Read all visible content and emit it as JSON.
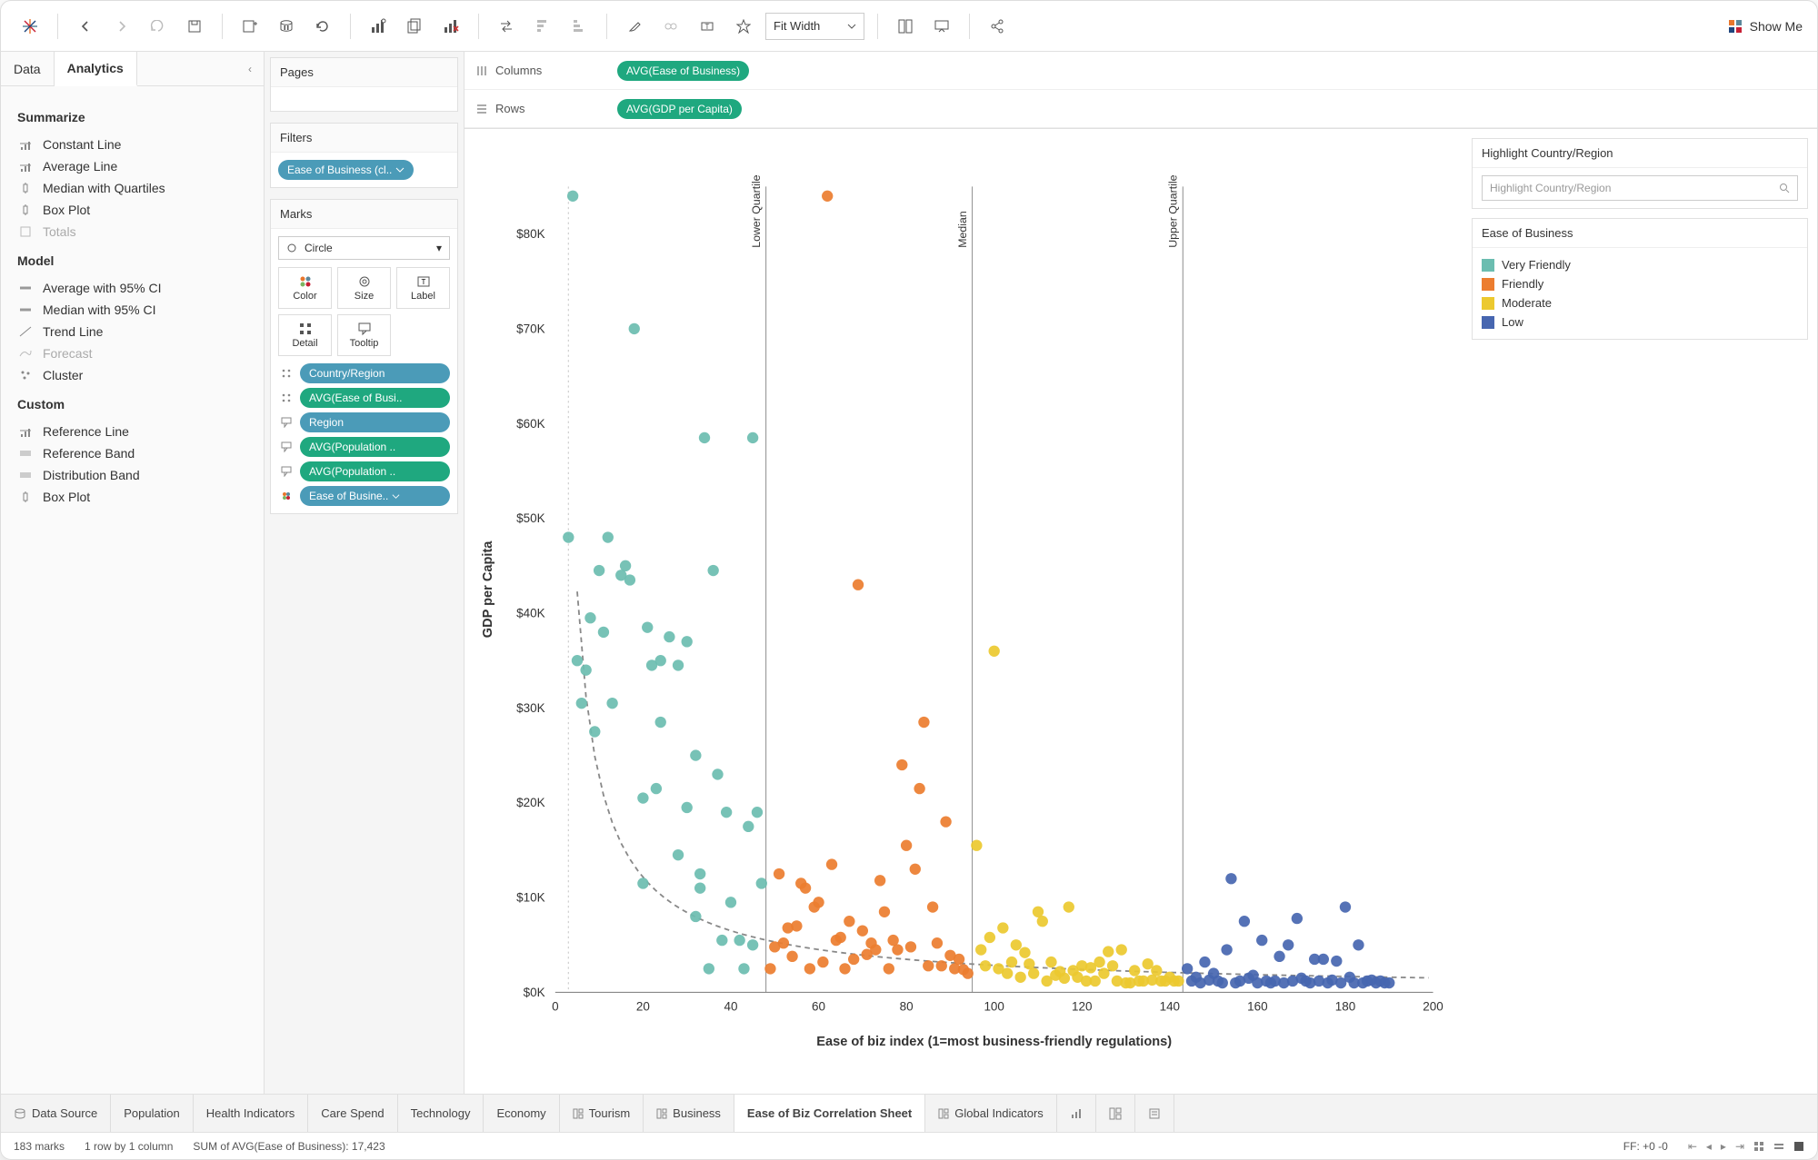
{
  "toolbar": {
    "fit_mode": "Fit Width",
    "show_me": "Show Me"
  },
  "left_tabs": {
    "data": "Data",
    "analytics": "Analytics",
    "active": "analytics"
  },
  "analytics": {
    "summarize_title": "Summarize",
    "summarize": [
      "Constant Line",
      "Average Line",
      "Median with Quartiles",
      "Box Plot",
      "Totals"
    ],
    "model_title": "Model",
    "model": [
      "Average with 95% CI",
      "Median with 95% CI",
      "Trend Line",
      "Forecast",
      "Cluster"
    ],
    "custom_title": "Custom",
    "custom": [
      "Reference Line",
      "Reference Band",
      "Distribution Band",
      "Box Plot"
    ]
  },
  "mid": {
    "pages": "Pages",
    "filters": "Filters",
    "filter_pill": "Ease of Business (cl..",
    "marks": "Marks",
    "mark_type": "Circle",
    "cells": {
      "color": "Color",
      "size": "Size",
      "label": "Label",
      "detail": "Detail",
      "tooltip": "Tooltip"
    },
    "mark_pills": [
      {
        "label": "Country/Region",
        "color": "blue",
        "icon": "detail"
      },
      {
        "label": "AVG(Ease of Busi..",
        "color": "green",
        "icon": "detail"
      },
      {
        "label": "Region",
        "color": "blue",
        "icon": "tooltip"
      },
      {
        "label": "AVG(Population ..",
        "color": "green",
        "icon": "tooltip"
      },
      {
        "label": "AVG(Population ..",
        "color": "green",
        "icon": "tooltip"
      },
      {
        "label": "Ease of Busine..",
        "color": "blue",
        "icon": "color"
      }
    ]
  },
  "shelves": {
    "columns_label": "Columns",
    "columns_pill": "AVG(Ease of Business)",
    "rows_label": "Rows",
    "rows_pill": "AVG(GDP per Capita)"
  },
  "right": {
    "highlight_title": "Highlight Country/Region",
    "highlight_placeholder": "Highlight Country/Region",
    "legend_title": "Ease of Business",
    "legend": [
      {
        "label": "Very Friendly",
        "color": "#6bbdb0"
      },
      {
        "label": "Friendly",
        "color": "#ec7d2f"
      },
      {
        "label": "Moderate",
        "color": "#ecc92f"
      },
      {
        "label": "Low",
        "color": "#4766b0"
      }
    ]
  },
  "sheet_tabs": {
    "data_source": "Data Source",
    "tabs": [
      "Population",
      "Health Indicators",
      "Care Spend",
      "Technology",
      "Economy",
      "Tourism",
      "Business",
      "Ease of Biz Correlation Sheet",
      "Global Indicators"
    ],
    "active": "Ease of Biz Correlation Sheet"
  },
  "statusbar": {
    "marks": "183 marks",
    "rowcol": "1 row by 1 column",
    "sum": "SUM of AVG(Ease of Business): 17,423",
    "ff": "FF: +0 -0"
  },
  "chart_data": {
    "type": "scatter",
    "title": "",
    "xlabel": "Ease of biz index (1=most business-friendly regulations)",
    "ylabel": "GDP per Capita",
    "xlim": [
      0,
      200
    ],
    "ylim": [
      0,
      85000
    ],
    "xticks": [
      0,
      20,
      40,
      60,
      80,
      100,
      120,
      140,
      160,
      180,
      200
    ],
    "yticks": [
      0,
      10000,
      20000,
      30000,
      40000,
      50000,
      60000,
      70000,
      80000
    ],
    "ytick_labels": [
      "$0K",
      "$10K",
      "$20K",
      "$30K",
      "$40K",
      "$50K",
      "$60K",
      "$70K",
      "$80K"
    ],
    "ref_lines": [
      {
        "label": "Lower Quartile",
        "x": 48
      },
      {
        "label": "Median",
        "x": 95
      },
      {
        "label": "Upper Quartile",
        "x": 143
      }
    ],
    "trend": {
      "kind": "power",
      "a": 180000,
      "b": -0.9
    },
    "series": [
      {
        "name": "Very Friendly",
        "color": "#6bbdb0",
        "points": [
          [
            3,
            48000
          ],
          [
            4,
            84000
          ],
          [
            5,
            35000
          ],
          [
            6,
            30500
          ],
          [
            7,
            34000
          ],
          [
            8,
            39500
          ],
          [
            9,
            27500
          ],
          [
            10,
            44500
          ],
          [
            11,
            38000
          ],
          [
            12,
            48000
          ],
          [
            13,
            30500
          ],
          [
            15,
            44000
          ],
          [
            16,
            45000
          ],
          [
            17,
            43500
          ],
          [
            18,
            70000
          ],
          [
            20,
            11500
          ],
          [
            20,
            20500
          ],
          [
            21,
            38500
          ],
          [
            22,
            34500
          ],
          [
            23,
            21500
          ],
          [
            24,
            28500
          ],
          [
            24,
            35000
          ],
          [
            26,
            37500
          ],
          [
            28,
            14500
          ],
          [
            28,
            34500
          ],
          [
            30,
            37000
          ],
          [
            30,
            19500
          ],
          [
            32,
            25000
          ],
          [
            32,
            8000
          ],
          [
            33,
            12500
          ],
          [
            33,
            11000
          ],
          [
            34,
            58500
          ],
          [
            35,
            2500
          ],
          [
            36,
            44500
          ],
          [
            37,
            23000
          ],
          [
            38,
            5500
          ],
          [
            39,
            19000
          ],
          [
            40,
            9500
          ],
          [
            42,
            5500
          ],
          [
            43,
            2500
          ],
          [
            44,
            17500
          ],
          [
            45,
            5000
          ],
          [
            45,
            58500
          ],
          [
            46,
            19000
          ],
          [
            47,
            11500
          ]
        ]
      },
      {
        "name": "Friendly",
        "color": "#ec7d2f",
        "points": [
          [
            49,
            2500
          ],
          [
            50,
            4800
          ],
          [
            51,
            12500
          ],
          [
            52,
            5200
          ],
          [
            53,
            6800
          ],
          [
            54,
            3800
          ],
          [
            55,
            7000
          ],
          [
            56,
            11500
          ],
          [
            57,
            11000
          ],
          [
            58,
            2500
          ],
          [
            59,
            9000
          ],
          [
            60,
            9500
          ],
          [
            61,
            3200
          ],
          [
            62,
            84000
          ],
          [
            63,
            13500
          ],
          [
            64,
            5500
          ],
          [
            65,
            5800
          ],
          [
            66,
            2500
          ],
          [
            67,
            7500
          ],
          [
            68,
            3500
          ],
          [
            69,
            43000
          ],
          [
            70,
            6500
          ],
          [
            71,
            4000
          ],
          [
            72,
            5200
          ],
          [
            73,
            4500
          ],
          [
            74,
            11800
          ],
          [
            75,
            8500
          ],
          [
            76,
            2500
          ],
          [
            77,
            5500
          ],
          [
            78,
            4500
          ],
          [
            79,
            24000
          ],
          [
            80,
            15500
          ],
          [
            81,
            4800
          ],
          [
            82,
            13000
          ],
          [
            83,
            21500
          ],
          [
            84,
            28500
          ],
          [
            85,
            2800
          ],
          [
            86,
            9000
          ],
          [
            87,
            5200
          ],
          [
            88,
            2800
          ],
          [
            89,
            18000
          ],
          [
            90,
            3900
          ],
          [
            91,
            2500
          ],
          [
            92,
            3500
          ],
          [
            93,
            2400
          ],
          [
            94,
            2000
          ]
        ]
      },
      {
        "name": "Moderate",
        "color": "#ecc92f",
        "points": [
          [
            96,
            15500
          ],
          [
            97,
            4500
          ],
          [
            98,
            2800
          ],
          [
            99,
            5800
          ],
          [
            100,
            36000
          ],
          [
            101,
            2500
          ],
          [
            102,
            6800
          ],
          [
            103,
            2000
          ],
          [
            104,
            3200
          ],
          [
            105,
            5000
          ],
          [
            106,
            1600
          ],
          [
            107,
            4200
          ],
          [
            108,
            3000
          ],
          [
            109,
            2000
          ],
          [
            110,
            8500
          ],
          [
            111,
            7500
          ],
          [
            112,
            1200
          ],
          [
            113,
            3200
          ],
          [
            114,
            1800
          ],
          [
            115,
            2200
          ],
          [
            116,
            1500
          ],
          [
            117,
            9000
          ],
          [
            118,
            2300
          ],
          [
            119,
            1600
          ],
          [
            120,
            2800
          ],
          [
            121,
            1200
          ],
          [
            122,
            2600
          ],
          [
            123,
            1200
          ],
          [
            124,
            3200
          ],
          [
            125,
            2000
          ],
          [
            126,
            4300
          ],
          [
            127,
            2800
          ],
          [
            128,
            1200
          ],
          [
            129,
            4500
          ],
          [
            130,
            1000
          ],
          [
            131,
            1000
          ],
          [
            132,
            2300
          ],
          [
            133,
            1200
          ],
          [
            134,
            1200
          ],
          [
            135,
            3000
          ],
          [
            136,
            1300
          ],
          [
            137,
            2300
          ],
          [
            138,
            1200
          ],
          [
            139,
            1200
          ],
          [
            140,
            1600
          ],
          [
            141,
            1200
          ],
          [
            142,
            1200
          ]
        ]
      },
      {
        "name": "Low",
        "color": "#4766b0",
        "points": [
          [
            144,
            2500
          ],
          [
            145,
            1200
          ],
          [
            146,
            1600
          ],
          [
            147,
            1000
          ],
          [
            148,
            3200
          ],
          [
            149,
            1300
          ],
          [
            150,
            2000
          ],
          [
            151,
            1200
          ],
          [
            152,
            1000
          ],
          [
            153,
            4500
          ],
          [
            154,
            12000
          ],
          [
            155,
            1000
          ],
          [
            156,
            1200
          ],
          [
            157,
            7500
          ],
          [
            158,
            1500
          ],
          [
            159,
            1800
          ],
          [
            160,
            1000
          ],
          [
            161,
            5500
          ],
          [
            162,
            1200
          ],
          [
            163,
            1000
          ],
          [
            164,
            1200
          ],
          [
            165,
            3800
          ],
          [
            166,
            1000
          ],
          [
            167,
            5000
          ],
          [
            168,
            1200
          ],
          [
            169,
            7800
          ],
          [
            170,
            1500
          ],
          [
            171,
            1200
          ],
          [
            172,
            1000
          ],
          [
            173,
            3500
          ],
          [
            174,
            1200
          ],
          [
            175,
            3500
          ],
          [
            176,
            1000
          ],
          [
            177,
            1300
          ],
          [
            178,
            3300
          ],
          [
            179,
            1000
          ],
          [
            180,
            9000
          ],
          [
            181,
            1600
          ],
          [
            182,
            1000
          ],
          [
            183,
            5000
          ],
          [
            184,
            1000
          ],
          [
            185,
            1200
          ],
          [
            186,
            1300
          ],
          [
            187,
            1000
          ],
          [
            188,
            1200
          ],
          [
            189,
            1000
          ],
          [
            190,
            1000
          ]
        ]
      }
    ]
  }
}
